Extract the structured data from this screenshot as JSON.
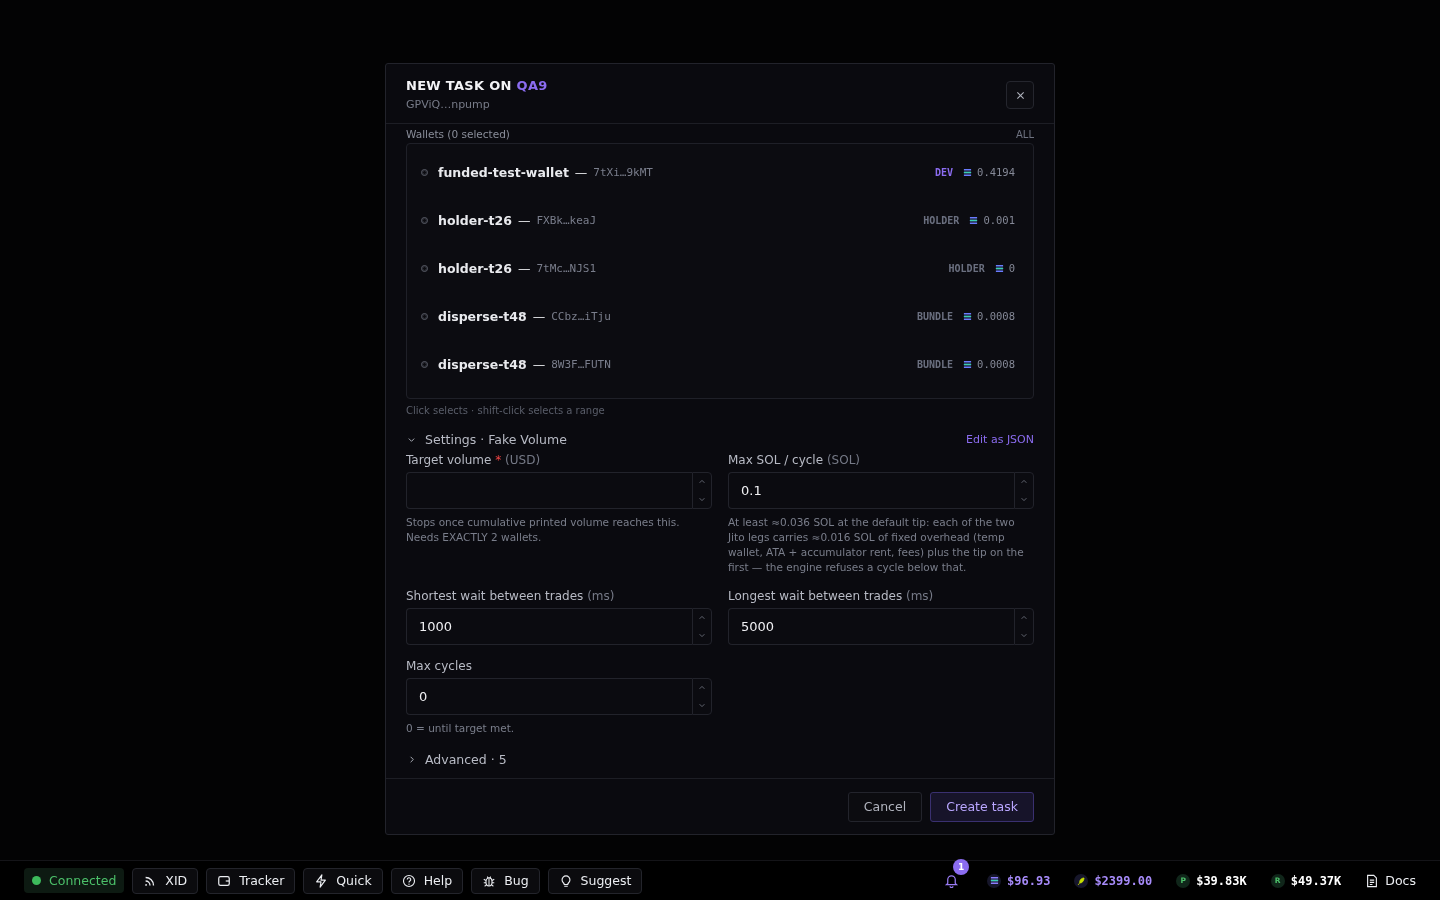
{
  "dialog": {
    "title": "NEW TASK ON",
    "title_accent": "QA9",
    "subtitle": "GPViQ…npump",
    "wallets": {
      "label": "Wallets (0 selected)",
      "all_link": "ALL",
      "separator": "—",
      "items": [
        {
          "name": "funded-test-wallet",
          "address": "7tXi…9kMT",
          "role": "DEV",
          "color": "#8b6cf0",
          "balance": "0.4194",
          "selected": false
        },
        {
          "name": "holder-t26",
          "address": "FXBk…keaJ",
          "role": "HOLDER",
          "color": "#6b7080",
          "balance": "0.001",
          "selected": false
        },
        {
          "name": "holder-t26",
          "address": "7tMc…NJS1",
          "role": "HOLDER",
          "color": "#6b7080",
          "balance": "0",
          "selected": false
        },
        {
          "name": "disperse-t48",
          "address": "CCbz…iTju",
          "role": "BUNDLE",
          "color": "#6b7080",
          "balance": "0.0008",
          "selected": false
        },
        {
          "name": "disperse-t48",
          "address": "8W3F…FUTN",
          "role": "BUNDLE",
          "color": "#6b7080",
          "balance": "0.0008",
          "selected": false
        }
      ],
      "hint": "Click selects · shift-click selects a range"
    },
    "settings": {
      "title": "Settings · Fake Volume",
      "expanded": true,
      "edit_link": "Edit as JSON",
      "fields": [
        {
          "label": "Target volume",
          "required_mark": "*",
          "unit": "(USD)",
          "hint": "Stops once cumulative printed volume reaches this. Needs EXACTLY 2 wallets."
        },
        {
          "label": "Max SOL / cycle",
          "unit": "(SOL)",
          "value": "0.1",
          "hint": "At least ≈0.036 SOL at the default tip: each of the two Jito legs carries ≈0.016 SOL of fixed overhead (temp wallet, ATA + accumulator rent, fees) plus the tip on the first — the engine refuses a cycle below that."
        },
        {
          "label": "Shortest wait between trades",
          "unit": "(ms)",
          "value": "1000"
        },
        {
          "label": "Longest wait between trades",
          "unit": "(ms)",
          "value": "5000"
        },
        {
          "label": "Max cycles",
          "value": "0",
          "hint": "0 = until target met."
        }
      ]
    },
    "advanced": {
      "title": "Advanced · 5",
      "expanded": false
    },
    "buttons": [
      {
        "label": "Cancel",
        "kind": "secondary"
      },
      {
        "label": "Create task",
        "kind": "primary"
      }
    ]
  },
  "status_bar": {
    "connection": "Connected",
    "buttons": [
      {
        "label": "XID"
      },
      {
        "label": "Tracker"
      },
      {
        "label": "Quick"
      },
      {
        "label": "Help"
      },
      {
        "label": "Bug"
      },
      {
        "label": "Suggest"
      }
    ],
    "notifications": "1",
    "prices": [
      {
        "value": "$96.93",
        "color": "#a78bfa"
      },
      {
        "value": "$2399.00",
        "color": "#a78bfa"
      },
      {
        "symbol": "P",
        "value": "$39.83K",
        "color": "#ffffff"
      },
      {
        "symbol": "R",
        "value": "$49.37K",
        "color": "#ffffff"
      }
    ],
    "docs": "Docs"
  }
}
